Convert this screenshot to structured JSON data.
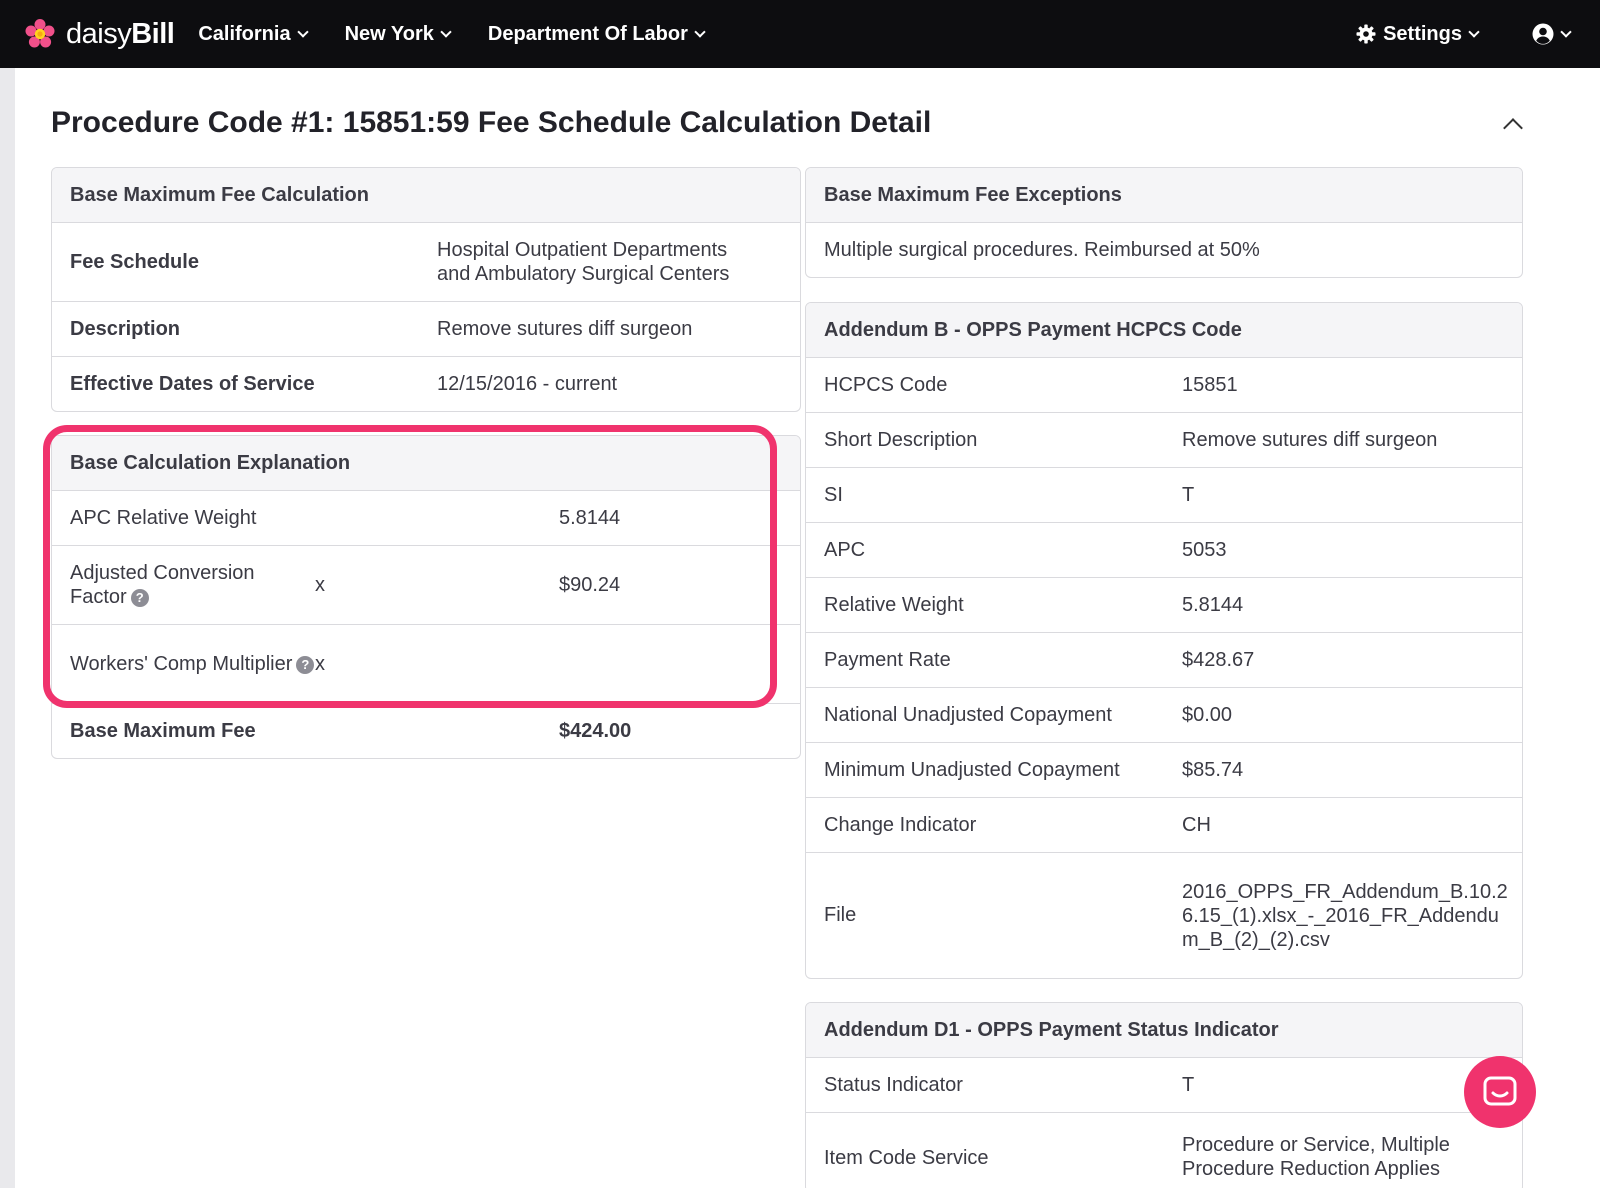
{
  "nav": {
    "brand_light": "daisy",
    "brand_bold": "Bill",
    "items": [
      {
        "label": "California"
      },
      {
        "label": "New York"
      },
      {
        "label": "Department Of Labor"
      }
    ],
    "settings_label": "Settings"
  },
  "page": {
    "title_bold": "Procedure Code #1: 15851:59",
    "title_rest": " Fee Schedule Calculation Detail"
  },
  "base_fee": {
    "header": "Base Maximum Fee Calculation",
    "rows": [
      {
        "label": "Fee Schedule",
        "value": "Hospital Outpatient Departments and Ambulatory Surgical Centers"
      },
      {
        "label": "Description",
        "value": "Remove sutures diff surgeon"
      },
      {
        "label": "Effective Dates of Service",
        "value": "12/15/2016 - current"
      }
    ]
  },
  "explanation": {
    "header": "Base Calculation Explanation",
    "rows": [
      {
        "label": "APC Relative Weight",
        "op": "",
        "value": "5.8144"
      },
      {
        "label": "Adjusted Conversion Factor",
        "op": "x",
        "value": "$90.24"
      },
      {
        "label": "Workers' Comp Multiplier",
        "op": "x",
        "value": ""
      }
    ],
    "total_label": "Base Maximum Fee",
    "total_value": "$424.00"
  },
  "exceptions": {
    "header": "Base Maximum Fee Exceptions",
    "text": "Multiple surgical procedures. Reimbursed at 50%"
  },
  "addendum_b": {
    "header": "Addendum B - OPPS Payment HCPCS Code",
    "rows": [
      {
        "label": "HCPCS Code",
        "value": "15851"
      },
      {
        "label": "Short Description",
        "value": "Remove sutures diff surgeon"
      },
      {
        "label": "SI",
        "value": "T"
      },
      {
        "label": "APC",
        "value": "5053"
      },
      {
        "label": "Relative Weight",
        "value": "5.8144"
      },
      {
        "label": "Payment Rate",
        "value": "$428.67"
      },
      {
        "label": "National Unadjusted Copayment",
        "value": "$0.00"
      },
      {
        "label": "Minimum Unadjusted Copayment",
        "value": "$85.74"
      },
      {
        "label": "Change Indicator",
        "value": "CH"
      },
      {
        "label": "File",
        "value": "2016_OPPS_FR_Addendum_B.10.26.15_(1).xlsx_-_2016_FR_Addendum_B_(2)_(2).csv"
      }
    ]
  },
  "addendum_d1": {
    "header": "Addendum D1 - OPPS Payment Status Indicator",
    "rows": [
      {
        "label": "Status Indicator",
        "value": "T"
      },
      {
        "label": "Item Code Service",
        "value": "Procedure or Service, Multiple Procedure Reduction Applies"
      }
    ]
  },
  "colors": {
    "nav_bg": "#0d0d10",
    "highlight": "#f0336d",
    "chat_button": "#f0336d"
  }
}
